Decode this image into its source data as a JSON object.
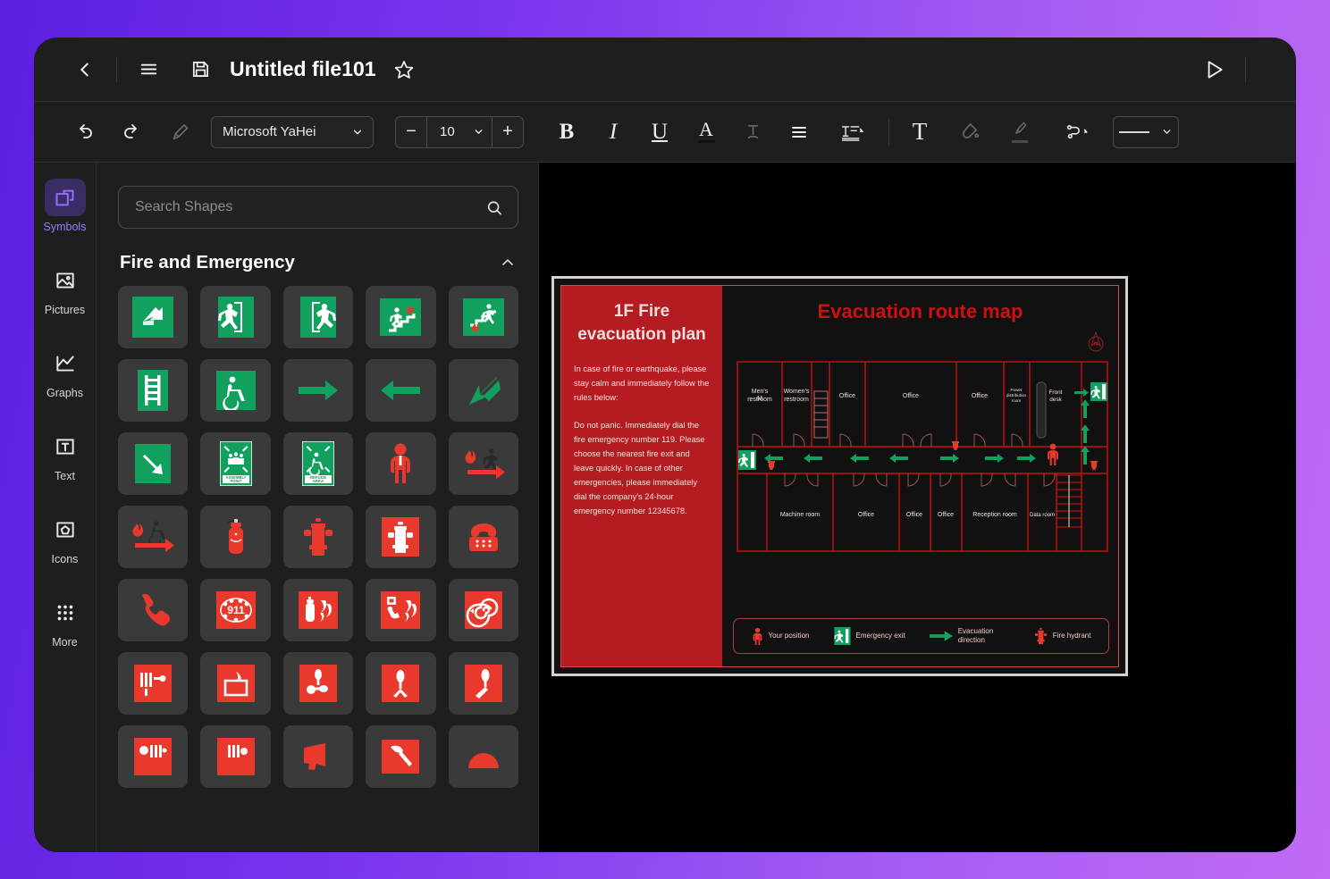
{
  "window": {
    "title": "Untitled file101"
  },
  "titlebar": {
    "back_icon": "chevron-left-icon",
    "menu_icon": "hamburger-menu-icon",
    "save_icon": "floppy-save-icon",
    "favorite_icon": "star-icon",
    "present_icon": "play-triangle-icon"
  },
  "toolbar": {
    "undo": "undo-icon",
    "redo": "redo-icon",
    "format_painter": "format-painter-icon",
    "font_family": "Microsoft YaHei",
    "font_size": "10",
    "decrease_label": "−",
    "increase_label": "+",
    "bold_label": "B",
    "italic_label": "I",
    "underline_label": "U",
    "font_color_label": "A",
    "strikethrough_label": "T",
    "align_icon": "align-left-icon",
    "line_spacing_icon": "line-spacing-icon",
    "text_label": "T",
    "fill_icon": "fill-bucket-icon",
    "brush_icon": "paint-brush-icon",
    "connector_icon": "connector-icon",
    "line_style_icon": "line-style-icon"
  },
  "sidebar": {
    "items": [
      {
        "label": "Symbols",
        "icon": "shapes-icon",
        "active": true
      },
      {
        "label": "Pictures",
        "icon": "picture-icon",
        "active": false
      },
      {
        "label": "Graphs",
        "icon": "chart-line-icon",
        "active": false
      },
      {
        "label": "Text",
        "icon": "text-box-icon",
        "active": false
      },
      {
        "label": "Icons",
        "icon": "pentagon-box-icon",
        "active": false
      },
      {
        "label": "More",
        "icon": "grid-dots-icon",
        "active": false
      }
    ]
  },
  "shapes_panel": {
    "search_placeholder": "Search Shapes",
    "search_value": "",
    "search_icon": "search-icon",
    "category": "Fire and Emergency",
    "collapse_icon": "chevron-up-icon",
    "shapes": [
      "exit-direction-arrow",
      "emergency-exit-right",
      "emergency-exit-left",
      "fire-stairs-right",
      "fire-stairs-left",
      "fire-ladder",
      "wheelchair-accessible",
      "arrow-right-green",
      "arrow-left-green",
      "arrow-down-left-green",
      "arrow-down-right-green",
      "assembly-point",
      "refuge-area",
      "person-red",
      "fire-escape-running",
      "fire-escape-wheelchair",
      "fire-extinguisher",
      "fire-hydrant",
      "fire-hydrant-sign",
      "emergency-telephone",
      "phone-handset",
      "call-911",
      "extinguisher-flame-sign",
      "manual-call-point",
      "fire-hose-reel",
      "alarm-bell",
      "fire-blanket",
      "valve-assembly",
      "sprinkler-valve",
      "hydrant-valve",
      "alarm-panel",
      "alarm-strobe",
      "megaphone",
      "fire-axe",
      "fire-dome-light"
    ]
  },
  "canvas": {
    "poster": {
      "title": "1F Fire evacuation plan",
      "paragraphs": [
        "In case of fire or earthquake, please stay calm and immediately follow the rules below:",
        "Do not panic. Immediately dial the fire emergency number 119. Please choose the nearest fire exit and leave quickly. In case of other emergencies, please immediately dial the company's 24-hour emergency number 12345678."
      ],
      "map_title": "Evacuation route map",
      "compass_label": "N",
      "rooms_top": [
        "Men's restroom",
        "Women's restroom",
        "",
        "Office",
        "Office",
        "Office",
        "Power distribution room",
        "Front desk"
      ],
      "rooms_bottom": [
        "Machine room",
        "Office",
        "Office",
        "Office",
        "Reception room",
        "Data room"
      ],
      "legend": [
        {
          "icon": "person-red-icon",
          "label": "Your position"
        },
        {
          "icon": "emergency-exit-icon",
          "label": "Emergency exit"
        },
        {
          "icon": "green-arrow-icon",
          "label": "Evacuation direction"
        },
        {
          "icon": "fire-hydrant-icon",
          "label": "Fire hydrant"
        }
      ]
    }
  },
  "colors": {
    "accent_purple": "#8f6bff",
    "green": "#12a05f",
    "red": "#e8392c",
    "poster_red": "#b51c22",
    "map_red": "#cc1111",
    "window_bg": "#1e1e1e",
    "canvas_bg": "#000000"
  }
}
